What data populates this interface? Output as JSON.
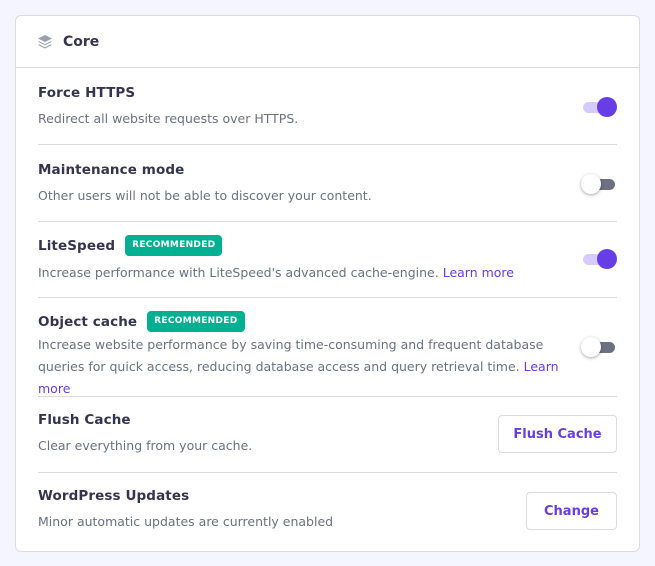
{
  "header": {
    "icon": "layers-icon",
    "title": "Core"
  },
  "colors": {
    "accent": "#673de6",
    "badge": "#00b090",
    "toggle_on_track": "#d5cbff",
    "toggle_off_track": "#6d7081"
  },
  "rows": [
    {
      "title": "Force HTTPS",
      "description": "Redirect all website requests over HTTPS.",
      "toggle_on": true
    },
    {
      "title": "Maintenance mode",
      "description": "Other users will not be able to discover your content.",
      "toggle_on": false
    },
    {
      "title": "LiteSpeed",
      "badge": "RECOMMENDED",
      "description": "Increase performance with LiteSpeed's advanced cache-engine.",
      "link": "Learn more",
      "toggle_on": true
    },
    {
      "title": "Object cache",
      "badge": "RECOMMENDED",
      "description": "Increase website performance by saving time-consuming and frequent database queries for quick access, reducing database access and query retrieval time.",
      "link": "Learn more",
      "toggle_on": false
    },
    {
      "title": "Flush Cache",
      "description": "Clear everything from your cache.",
      "button": "Flush Cache"
    },
    {
      "title": "WordPress Updates",
      "description": "Minor automatic updates are currently enabled",
      "button": "Change"
    }
  ]
}
